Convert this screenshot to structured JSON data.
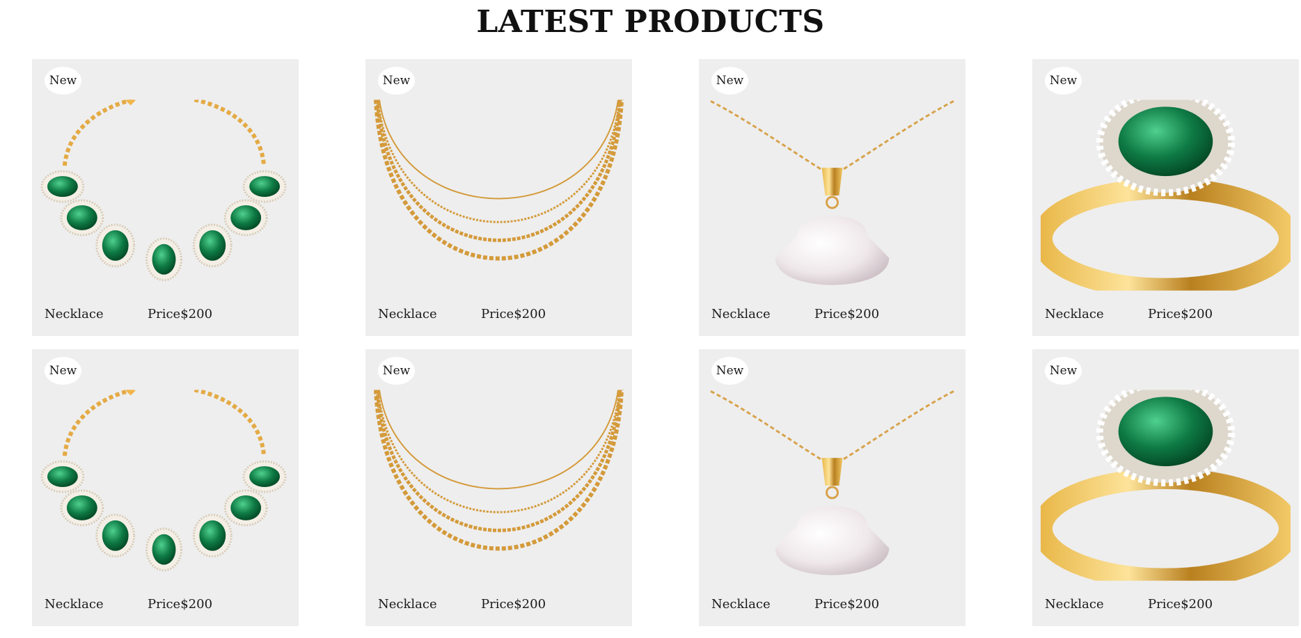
{
  "section": {
    "title": "LATEST PRODUCTS"
  },
  "products": [
    {
      "badge": "New",
      "name": "Necklace",
      "price": "Price$200",
      "image": "emerald-necklace"
    },
    {
      "badge": "New",
      "name": "Necklace",
      "price": "Price$200",
      "image": "gold-chain-necklace"
    },
    {
      "badge": "New",
      "name": "Necklace",
      "price": "Price$200",
      "image": "pearl-pendant"
    },
    {
      "badge": "New",
      "name": "Necklace",
      "price": "Price$200",
      "image": "emerald-ring"
    },
    {
      "badge": "New",
      "name": "Necklace",
      "price": "Price$200",
      "image": "emerald-necklace"
    },
    {
      "badge": "New",
      "name": "Necklace",
      "price": "Price$200",
      "image": "gold-chain-necklace"
    },
    {
      "badge": "New",
      "name": "Necklace",
      "price": "Price$200",
      "image": "pearl-pendant"
    },
    {
      "badge": "New",
      "name": "Necklace",
      "price": "Price$200",
      "image": "emerald-ring"
    }
  ],
  "colors": {
    "card_bg": "#eeeeee",
    "gold": "#d9a441",
    "emerald": "#0f7a45",
    "pearl": "#f1ecee"
  }
}
